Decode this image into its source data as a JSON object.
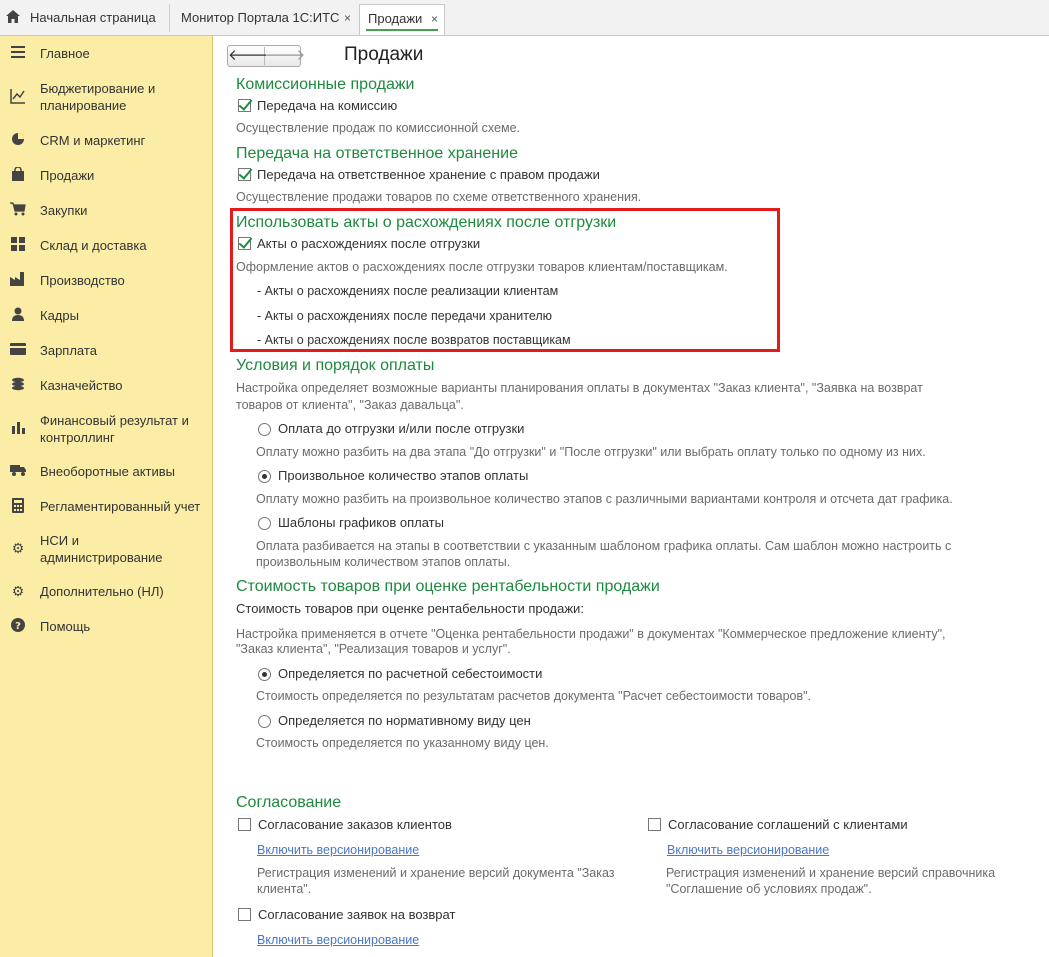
{
  "tabs": {
    "home": "Начальная страница",
    "monitor": "Монитор Портала 1С:ИТС",
    "sales": "Продажи",
    "close": "×"
  },
  "sidebar": {
    "items": [
      {
        "label": "Главное",
        "icon": "menu-lines-icon"
      },
      {
        "label": "Бюджетирование и планирование",
        "icon": "budget-chart-icon"
      },
      {
        "label": "CRM и маркетинг",
        "icon": "pie-chart-icon"
      },
      {
        "label": "Продажи",
        "icon": "shopping-bag-icon"
      },
      {
        "label": "Закупки",
        "icon": "cart-icon"
      },
      {
        "label": "Склад и доставка",
        "icon": "grid-boxes-icon"
      },
      {
        "label": "Производство",
        "icon": "factory-icon"
      },
      {
        "label": "Кадры",
        "icon": "person-icon"
      },
      {
        "label": "Зарплата",
        "icon": "card-icon"
      },
      {
        "label": "Казначейство",
        "icon": "coins-icon"
      },
      {
        "label": "Финансовый результат и контроллинг",
        "icon": "bar-chart-icon"
      },
      {
        "label": "Внеоборотные активы",
        "icon": "truck-icon"
      },
      {
        "label": "Регламентированный учет",
        "icon": "calculator-icon"
      },
      {
        "label": "НСИ и администрирование",
        "icon": "gear-icon"
      },
      {
        "label": "Дополнительно (НЛ)",
        "icon": "gear-outline-icon"
      },
      {
        "label": "Помощь",
        "icon": "help-icon"
      }
    ]
  },
  "page": {
    "title": "Продажи",
    "back": "🡐",
    "forward": "🡒"
  },
  "commission": {
    "heading": "Комиссионные продажи",
    "checkbox": "Передача на комиссию",
    "checked": true,
    "note": "Осуществление продаж по комиссионной схеме."
  },
  "custody": {
    "heading": "Передача на ответственное хранение",
    "checkbox": "Передача на ответственное хранение с правом продажи",
    "checked": true,
    "note": "Осуществление продажи товаров по схеме ответственного хранения."
  },
  "acts": {
    "heading": "Использовать акты о расхождениях после отгрузки",
    "checkbox": "Акты о расхождениях после отгрузки",
    "checked": true,
    "note": "Оформление актов о расхождениях после отгрузки товаров клиентам/поставщикам.",
    "list": [
      "- Акты о расхождениях после реализации клиентам",
      "- Акты о расхождениях после передачи хранителю",
      "- Акты о расхождениях после возвратов поставщикам"
    ]
  },
  "payment": {
    "heading": "Условия и порядок оплаты",
    "note_line1": "Настройка определяет возможные варианты планирования оплаты в документах \"Заказ клиента\", \"Заявка на возврат",
    "note_line2": "товаров от клиента\", \"Заказ давальца\".",
    "options": [
      {
        "label": "Оплата до отгрузки и/или после отгрузки",
        "selected": false,
        "note": [
          "Оплату можно разбить на два этапа \"До отгрузки\" и \"После отгрузки\" или выбрать оплату только по одному из них."
        ]
      },
      {
        "label": "Произвольное количество этапов оплаты",
        "selected": true,
        "note": [
          "Оплату можно разбить на произвольное количество этапов с различными вариантами контроля и отсчета дат графика."
        ]
      },
      {
        "label": "Шаблоны графиков оплаты",
        "selected": false,
        "note": [
          "Оплата разбивается на этапы в соответствии с указанным шаблоном графика оплаты. Сам шаблон можно настроить с",
          "произвольным количеством этапов оплаты."
        ]
      }
    ]
  },
  "cost": {
    "heading": "Стоимость товаров при оценке рентабельности продажи",
    "label": "Стоимость товаров при оценке рентабельности продажи:",
    "note_line1": "Настройка применяется в отчете \"Оценка рентабельности продажи\" в документах \"Коммерческое предложение клиенту\",",
    "note_line2": "\"Заказ клиента\", \"Реализация товаров и услуг\".",
    "options": [
      {
        "label": "Определяется по расчетной себестоимости",
        "selected": true,
        "note": "Стоимость определяется по результатам расчетов документа \"Расчет себестоимости товаров\"."
      },
      {
        "label": "Определяется по нормативному виду цен",
        "selected": false,
        "note": "Стоимость определяется по указанному виду цен."
      }
    ]
  },
  "approval": {
    "heading": "Согласование",
    "orders": {
      "checkbox": "Согласование заказов клиентов",
      "checked": false,
      "link": "Включить версионирование",
      "note": [
        "Регистрация изменений и хранение версий документа \"Заказ",
        "клиента\"."
      ]
    },
    "agreements": {
      "checkbox": "Согласование соглашений с клиентами",
      "checked": false,
      "link": "Включить версионирование",
      "note": [
        "Регистрация изменений и хранение версий справочника",
        "\"Соглашение об условиях продаж\"."
      ]
    },
    "returns": {
      "checkbox": "Согласование заявок на возврат",
      "checked": false,
      "link": "Включить версионирование"
    }
  }
}
